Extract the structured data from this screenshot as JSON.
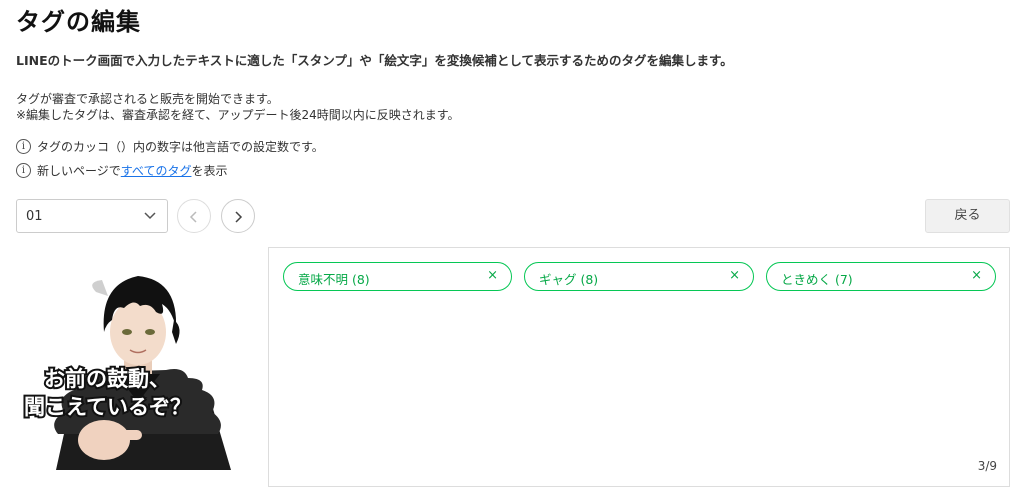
{
  "header": {
    "title": "タグの編集",
    "description": "LINEのトーク画面で入力したテキストに適した「スタンプ」や「絵文字」を変換候補として表示するためのタグを編集します。"
  },
  "notes": {
    "line1": "タグが審査で承認されると販売を開始できます。",
    "line2": "※編集したタグは、審査承認を経て、アップデート後24時間以内に反映されます。"
  },
  "info": {
    "icon": "info-icon",
    "line1": "タグのカッコ（）内の数字は他言語での設定数です。",
    "line2_prefix": "新しいページで",
    "line2_link": "すべてのタグ",
    "line2_suffix": "を表示"
  },
  "controls": {
    "select_value": "01",
    "back_label": "戻る"
  },
  "sticker": {
    "caption_line1": "お前の鼓動、",
    "caption_line2": "聞こえているぞ？"
  },
  "tags": {
    "items": [
      {
        "label": "意味不明 (8)"
      },
      {
        "label": "ギャグ (8)"
      },
      {
        "label": "ときめく (7)"
      }
    ],
    "remove_glyph": "×",
    "counter": "3/9"
  },
  "colors": {
    "accent": "#06c755",
    "link": "#1a73e8"
  }
}
